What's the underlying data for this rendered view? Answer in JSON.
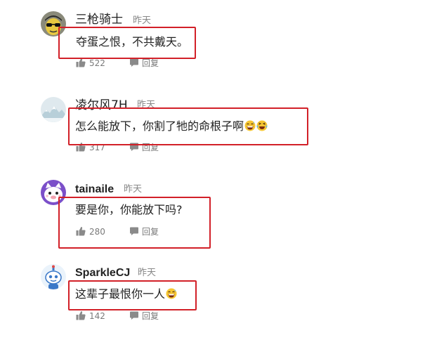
{
  "comments": [
    {
      "username": "三枪骑士",
      "time": "昨天",
      "text": "夺蛋之恨，不共戴天。",
      "likes": "522",
      "reply_label": "回复",
      "emojis": [],
      "avatar_icon": "cartoon-face-sunglasses-avatar"
    },
    {
      "username": "凌尔风7H",
      "time": "昨天",
      "text": "怎么能放下，你割了牠的命根子啊",
      "likes": "317",
      "reply_label": "回复",
      "emojis": [
        "grinning-sweat-emoji",
        "crying-laughing-emoji"
      ],
      "avatar_icon": "snowy-mountain-avatar"
    },
    {
      "username": "tainaile",
      "time": "昨天",
      "text": "要是你，你能放下吗?",
      "likes": "280",
      "reply_label": "回复",
      "emojis": [],
      "avatar_icon": "cartoon-cat-avatar"
    },
    {
      "username": "SparkleCJ",
      "time": "昨天",
      "text": "这辈子最恨你一人",
      "likes": "142",
      "reply_label": "回复",
      "emojis": [
        "grinning-sweat-emoji"
      ],
      "avatar_icon": "robot-mascot-avatar"
    }
  ],
  "colors": {
    "highlight_border": "#d22028",
    "username": "#222222",
    "time": "#888888",
    "action_text": "#7a7a7a"
  }
}
